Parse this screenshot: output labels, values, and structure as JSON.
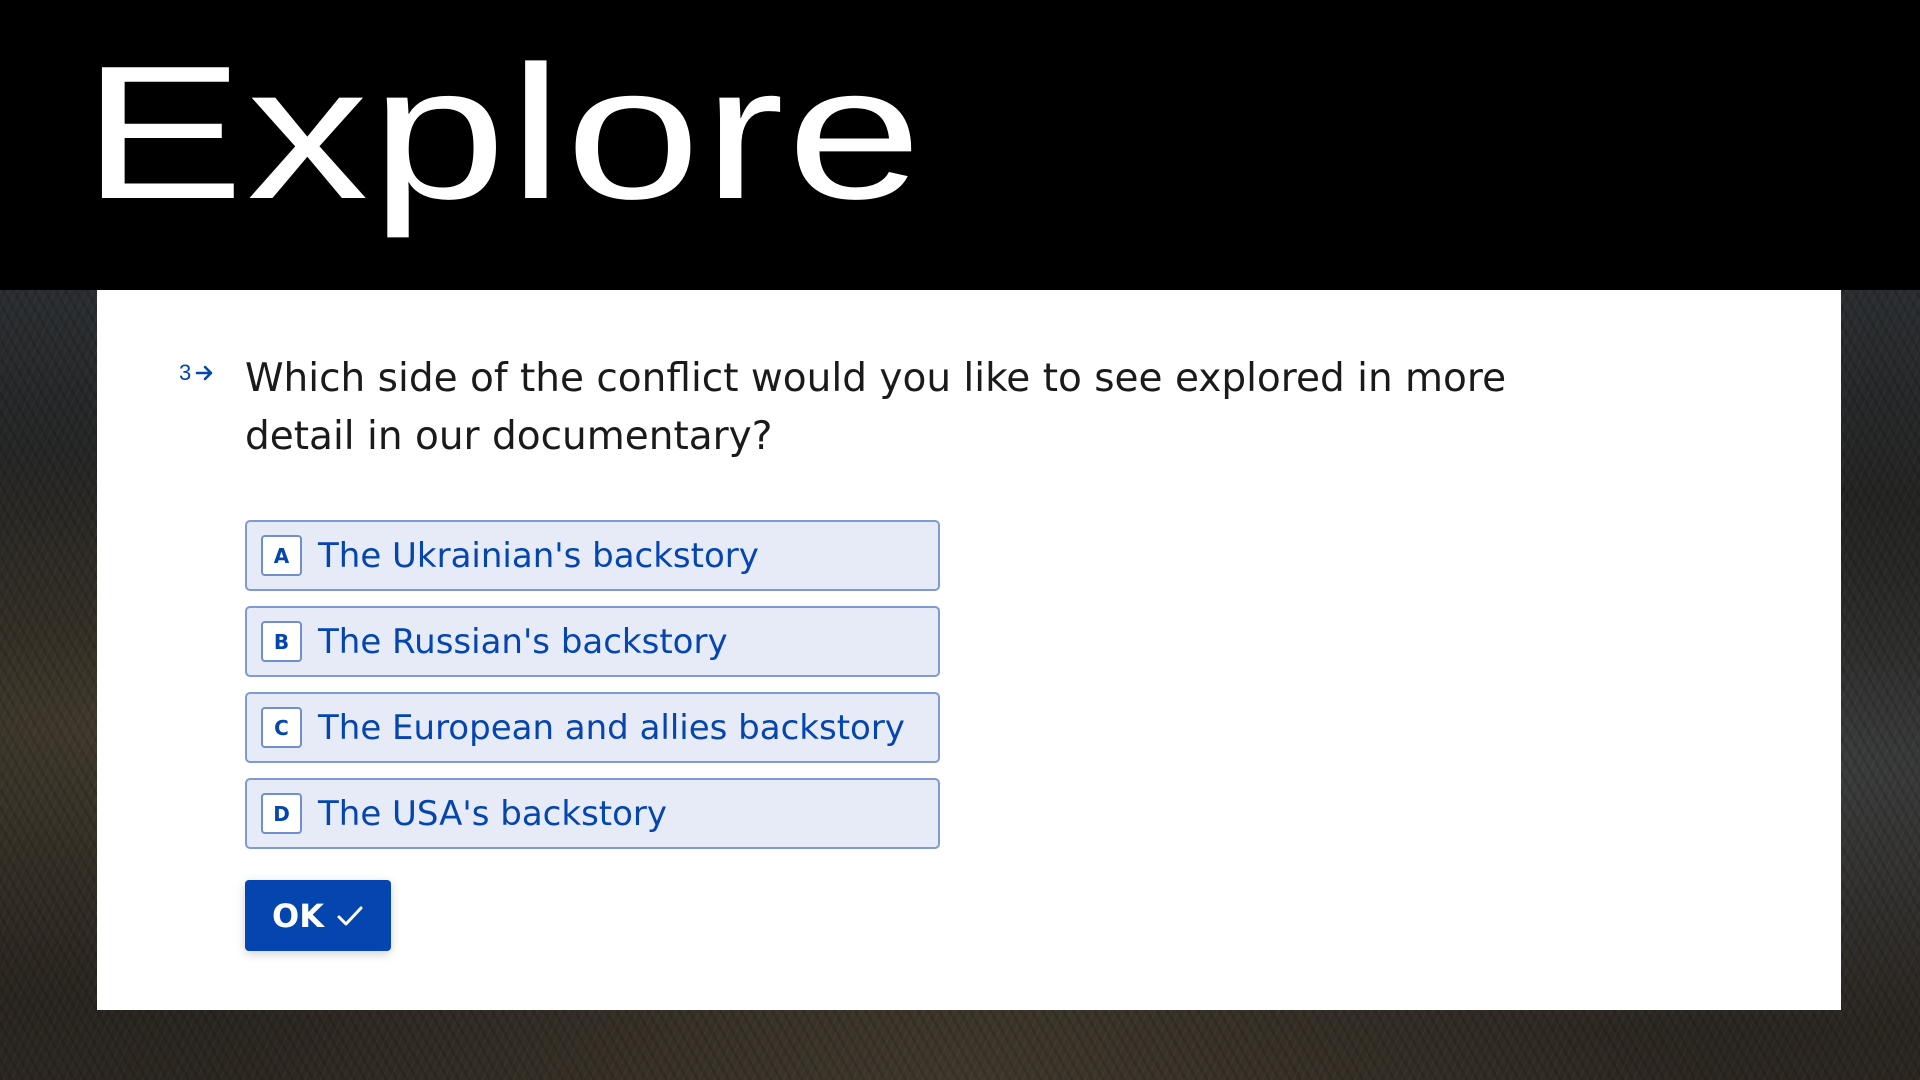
{
  "banner": {
    "title": "Explore"
  },
  "form": {
    "question_number": "3",
    "question_text": "Which side of the conflict would you like to see explored in more detail in our documentary?",
    "choices": [
      {
        "key": "A",
        "label": "The Ukrainian's backstory"
      },
      {
        "key": "B",
        "label": "The Russian's backstory"
      },
      {
        "key": "C",
        "label": "The European and allies backstory"
      },
      {
        "key": "D",
        "label": "The USA's backstory"
      }
    ],
    "submit_label": "OK"
  },
  "colors": {
    "accent": "#0445AF",
    "choice_bg": "#E6EBF7",
    "choice_border": "#7F9BD3",
    "banner_bg": "#000000",
    "card_bg": "#FFFFFF"
  },
  "icons": {
    "question_arrow": "arrow-right-icon",
    "submit_check": "check-icon"
  }
}
